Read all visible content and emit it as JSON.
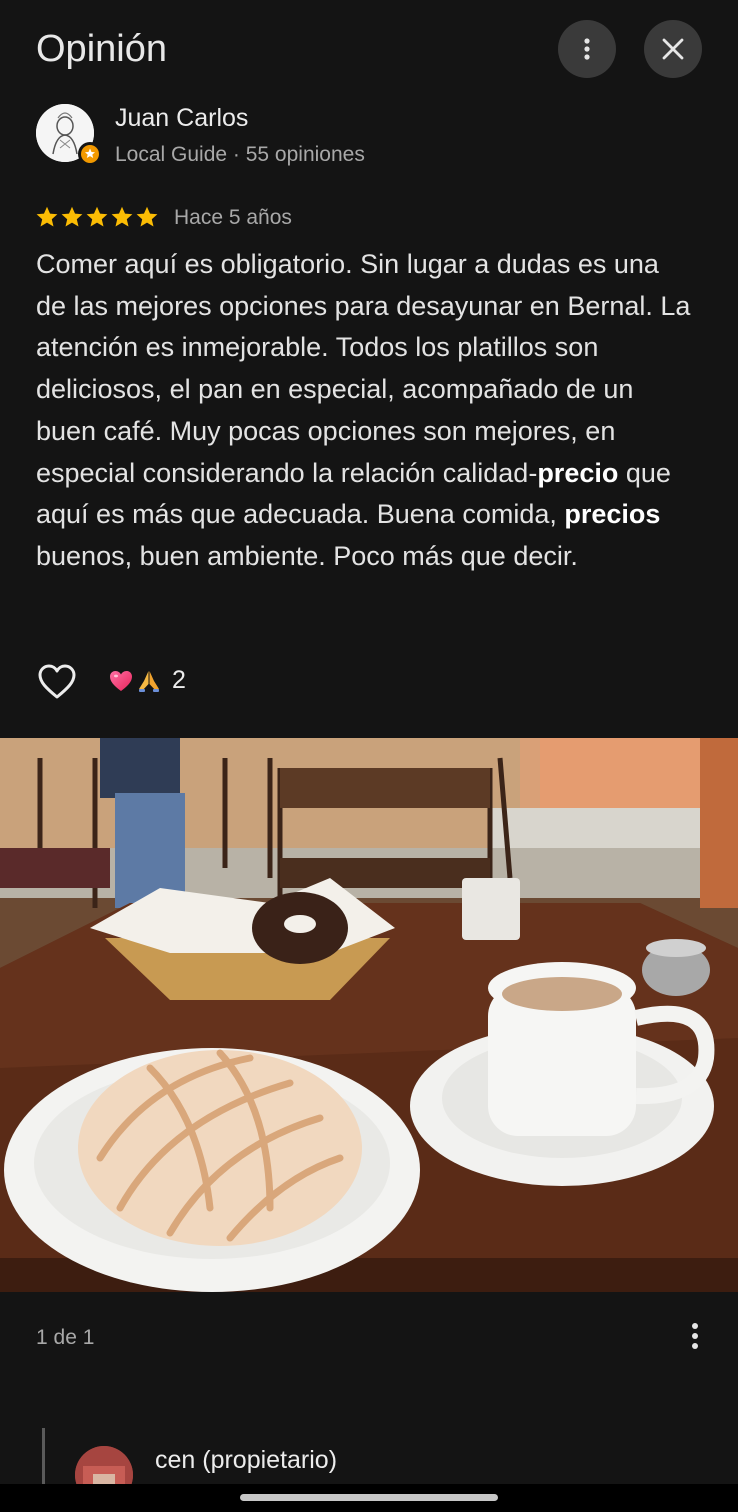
{
  "header": {
    "title": "Opinión",
    "more_icon": "more-vert-icon",
    "close_icon": "close-icon"
  },
  "reviewer": {
    "name": "Juan Carlos",
    "meta": "Local Guide · 55 opiniones",
    "badge_color": "#f29900"
  },
  "review": {
    "rating": 5,
    "max_rating": 5,
    "star_color": "#fbbc04",
    "date": "Hace 5 años",
    "text_before_1": "Comer aquí es obligatorio. Sin lugar a dudas es una de las mejores opciones para desayunar en Bernal. La atención es inmejorable. Todos los platillos son deliciosos, el pan en especial, acompañado de un buen café. Muy pocas opciones son mejores, en especial considerando la relación calidad-",
    "highlight_1": "precio",
    "text_between": " que aquí es más que adecuada. Buena comida, ",
    "highlight_2": "precios",
    "text_after": " buenos, buen ambiente. Poco más que decir."
  },
  "reactions": {
    "like_icon": "heart-outline-icon",
    "icons": [
      "heart-emoji-icon",
      "folded-hands-emoji-icon"
    ],
    "count": "2"
  },
  "photo": {
    "counter": "1 de 1",
    "more_icon": "more-vert-icon"
  },
  "owner_reply": {
    "name": "cen (propietario)"
  }
}
